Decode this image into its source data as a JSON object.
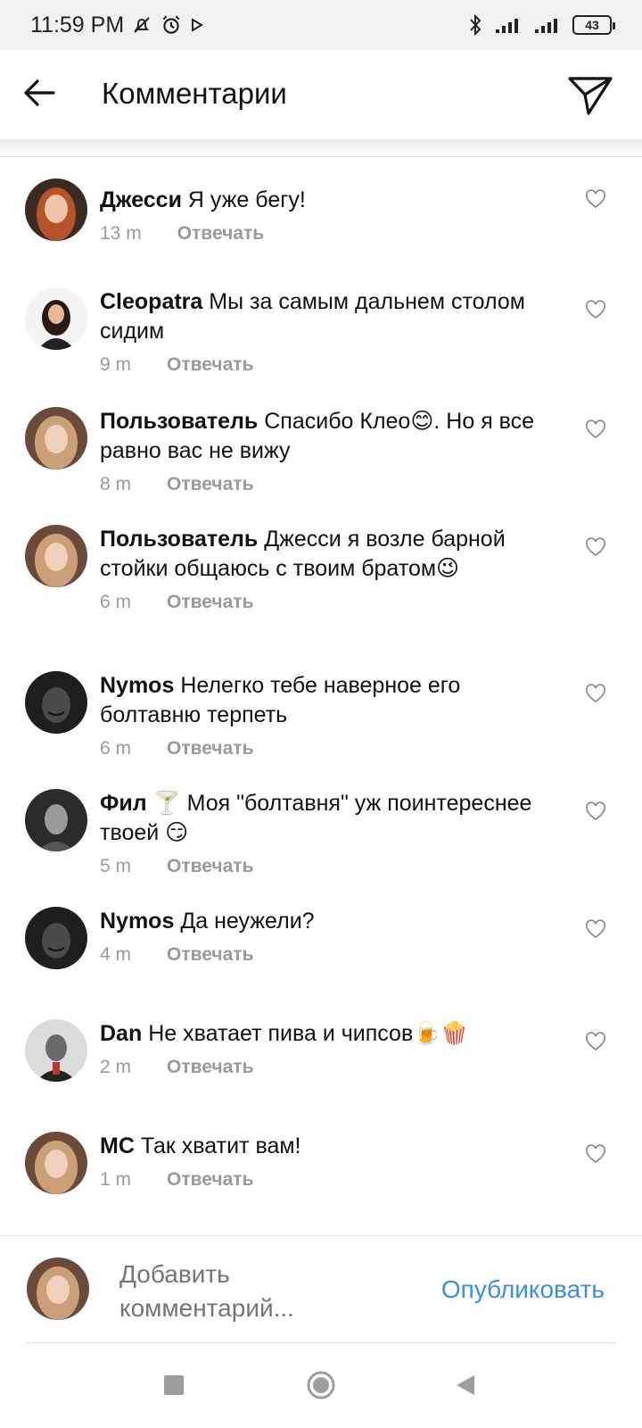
{
  "status_bar": {
    "time": "11:59 PM",
    "battery": "43",
    "icons": [
      "mute-icon",
      "alarm-icon",
      "play-icon",
      "bluetooth-icon",
      "signal-icon",
      "signal-icon",
      "battery-icon"
    ]
  },
  "header": {
    "title": "Комментарии",
    "back_icon": "arrow-left-icon",
    "send_icon": "paper-plane-icon"
  },
  "comments": [
    {
      "user": "Джесси",
      "text": "Я уже бегу!",
      "time": "13 m",
      "reply": "Отвечать",
      "avatar": "avatar-redhead"
    },
    {
      "user": "Cleopatra",
      "text": "Мы за самым дальнем столом сидим",
      "time": "9 m",
      "reply": "Отвечать",
      "avatar": "avatar-dark-hair"
    },
    {
      "user": "Пользователь",
      "text": "Спасибо Клео😊. Но я все равно вас не вижу",
      "time": "8 m",
      "reply": "Отвечать",
      "avatar": "avatar-blonde"
    },
    {
      "user": "Пользователь",
      "text": "Джесси я возле барной стойки общаюсь с твоим братом😉",
      "time": "6 m",
      "reply": "Отвечать",
      "avatar": "avatar-blonde"
    },
    {
      "user": "Nymos",
      "text": "Нелегко тебе наверное его болтавню терпеть",
      "time": "6 m",
      "reply": "Отвечать",
      "avatar": "avatar-mask"
    },
    {
      "user": "Фил 🍸",
      "text": "Моя \"болтавня\" уж поинтереснее твоей 😏",
      "time": "5 m",
      "reply": "Отвечать",
      "avatar": "avatar-man-bw"
    },
    {
      "user": "Nymos",
      "text": "Да неужели?",
      "time": "4 m",
      "reply": "Отвечать",
      "avatar": "avatar-mask"
    },
    {
      "user": "Dan",
      "text": "Не хватает пива и чипсов🍺🍿",
      "time": "2 m",
      "reply": "Отвечать",
      "avatar": "avatar-man-suit"
    },
    {
      "user": "MC",
      "text": "Так хватит вам!",
      "time": "1 m",
      "reply": "Отвечать",
      "avatar": "avatar-blonde"
    }
  ],
  "composer": {
    "placeholder": "Добавить комментарий...",
    "publish": "Опубликовать"
  },
  "colors": {
    "accent": "#3b8fe0",
    "muted": "#9a9a9a",
    "status_bg": "#f2f2f2"
  },
  "navigation": [
    "square-icon",
    "home-circle-icon",
    "back-triangle-icon"
  ]
}
